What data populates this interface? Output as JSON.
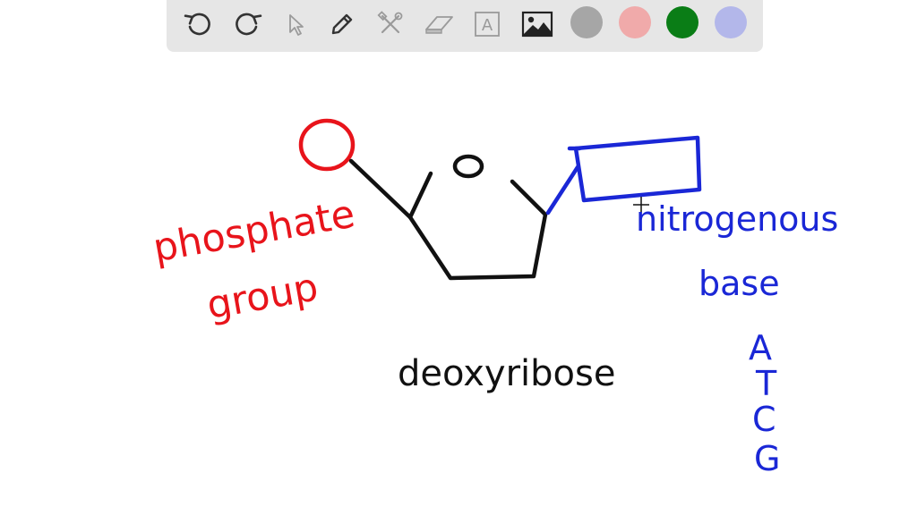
{
  "toolbar": {
    "tools": [
      {
        "name": "undo",
        "icon": "undo-icon"
      },
      {
        "name": "redo",
        "icon": "redo-icon"
      },
      {
        "name": "select",
        "icon": "cursor-arrow-icon"
      },
      {
        "name": "pen",
        "icon": "pencil-icon"
      },
      {
        "name": "tools",
        "icon": "hammer-wrench-icon"
      },
      {
        "name": "eraser",
        "icon": "eraser-icon"
      },
      {
        "name": "text",
        "icon": "text-box-icon",
        "glyph": "A"
      },
      {
        "name": "image",
        "icon": "image-icon"
      }
    ],
    "colors": [
      {
        "name": "gray",
        "hex": "#a6a6a6"
      },
      {
        "name": "pink",
        "hex": "#f0aaaa"
      },
      {
        "name": "green",
        "hex": "#0a7d16"
      },
      {
        "name": "lavender",
        "hex": "#b3b7ea"
      }
    ]
  },
  "drawing": {
    "labels": {
      "phosphate_line1": "phosphate",
      "phosphate_line2": "group",
      "sugar": "deoxyribose",
      "base_line1": "nitrogenous",
      "base_line2": "base",
      "ring_oxygen": "O",
      "bases": [
        "A",
        "T",
        "C",
        "G"
      ]
    },
    "colors": {
      "phosphate": "#e8141b",
      "sugar": "#111111",
      "base": "#1a27d6"
    }
  }
}
